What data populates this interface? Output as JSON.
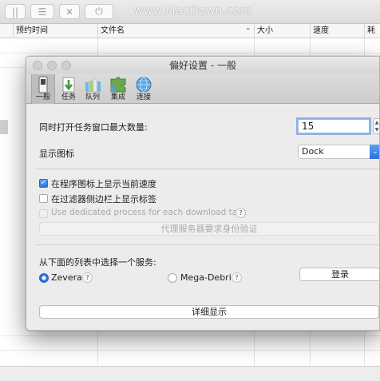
{
  "toolbar": {
    "watermark": "www.MacDown.com",
    "buttons": [
      {
        "icon": "pause-icon",
        "glyph": "||"
      },
      {
        "icon": "list-icon",
        "glyph": "☰"
      },
      {
        "icon": "close-icon",
        "glyph": "✕"
      },
      {
        "icon": "power-icon",
        "glyph": "⏻"
      }
    ]
  },
  "table": {
    "columns": [
      "预约时间",
      "文件名",
      "大小",
      "速度",
      "耗时"
    ]
  },
  "dialog": {
    "title": "偏好设置 - 一般",
    "tabs": [
      {
        "label": "一般",
        "icon": "switch-icon",
        "selected": true
      },
      {
        "label": "任务",
        "icon": "download-arrow-icon",
        "selected": false
      },
      {
        "label": "队列",
        "icon": "queue-icon",
        "selected": false
      },
      {
        "label": "集成",
        "icon": "puzzle-icon",
        "selected": false
      },
      {
        "label": "连接",
        "icon": "globe-icon",
        "selected": false
      }
    ],
    "max_tasks_label": "同时打开任务窗口最大数量:",
    "max_tasks_value": "15",
    "show_icon_label": "显示图标",
    "show_icon_value": "Dock",
    "checkbox_speed": "在程序图标上显示当前速度",
    "checkbox_tags": "在过滤器侧边栏上显示标签",
    "checkbox_dedicated": "Use dedicated process for each download task",
    "proxy_button": "代理服务器要求身份验证",
    "service_label": "从下面的列表中选择一个服务:",
    "service_zevera": "Zevera",
    "service_mega": "Mega-Debrid",
    "login_button": "登录",
    "details_button": "详细显示",
    "help_glyph": "?"
  }
}
